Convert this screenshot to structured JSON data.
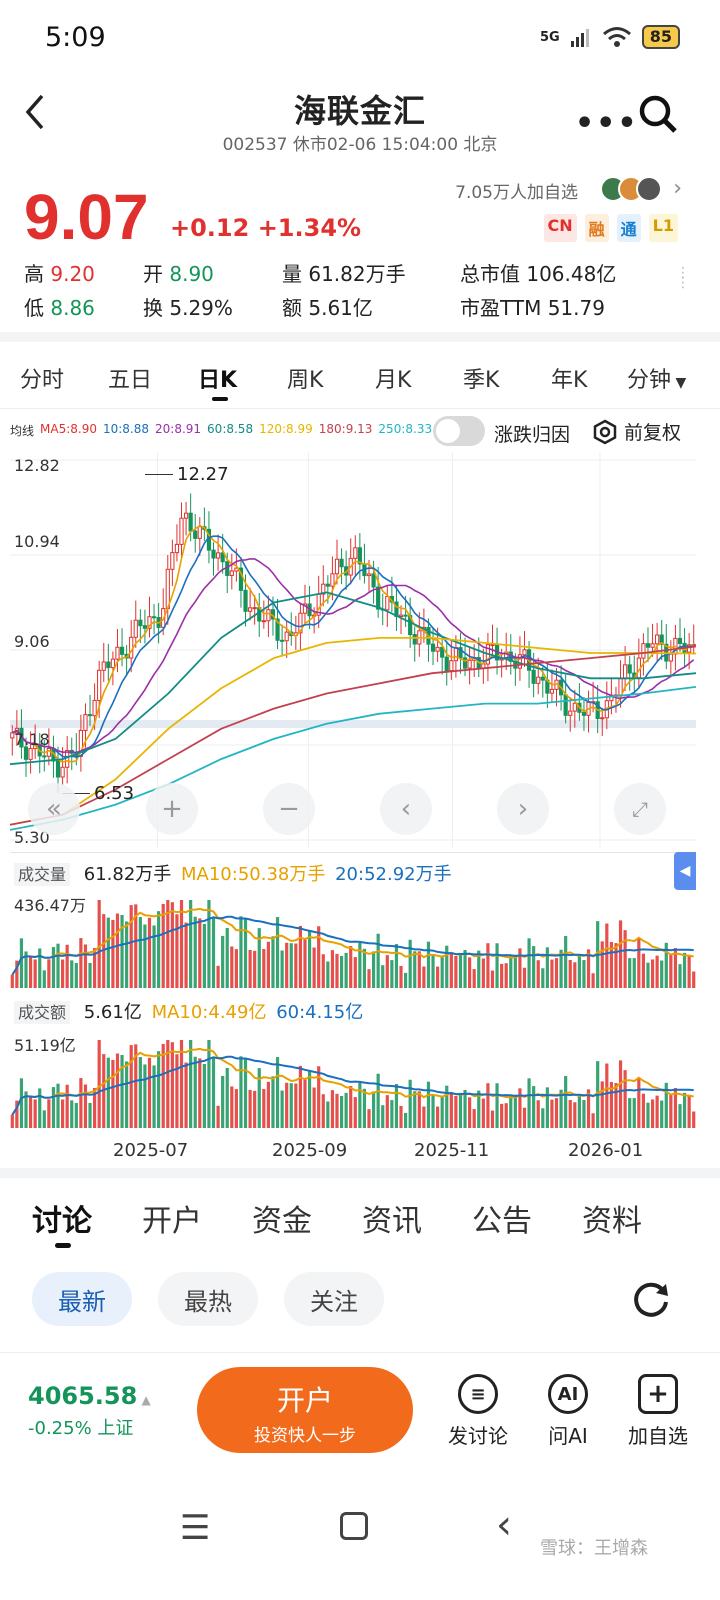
{
  "status_bar": {
    "time": "5:09",
    "network": "5G",
    "battery": "85"
  },
  "header": {
    "title": "海联金汇",
    "subtitle": "002537 休市02-06 15:04:00 北京"
  },
  "quote": {
    "price": "9.07",
    "change": "+0.12",
    "change_pct": "+1.34%",
    "followers": "7.05万人加自选",
    "badges": [
      "CN",
      "融",
      "通",
      "L1"
    ],
    "high_label": "高",
    "high": "9.20",
    "low_label": "低",
    "low": "8.86",
    "open_label": "开",
    "open": "8.90",
    "turnover_label": "换",
    "turnover": "5.29%",
    "volume_label": "量",
    "volume": "61.82万手",
    "amount_label": "额",
    "amount": "5.61亿",
    "mktcap_label": "总市值",
    "mktcap": "106.48亿",
    "pe_label": "市盈TTM",
    "pe": "51.79"
  },
  "period_tabs": [
    "分时",
    "五日",
    "日K",
    "周K",
    "月K",
    "季K",
    "年K",
    "分钟"
  ],
  "active_period": "日K",
  "ma_legend": {
    "label": "均线",
    "items": [
      {
        "text": "MA5:8.90",
        "color": "#e0312e"
      },
      {
        "text": "10:8.88",
        "color": "#1a6fbf"
      },
      {
        "text": "20:8.91",
        "color": "#9b2fa8"
      },
      {
        "text": "60:8.58",
        "color": "#138c86"
      },
      {
        "text": "120:8.99",
        "color": "#e8b500"
      },
      {
        "text": "180:9.13",
        "color": "#c2414f"
      },
      {
        "text": "250:8.33",
        "color": "#22b5c4"
      }
    ],
    "toggle_label": "涨跌归因",
    "adjust_label": "前复权"
  },
  "chart_axes": {
    "price_ticks": [
      "12.82",
      "10.94",
      "9.06",
      "7.18",
      "5.30"
    ],
    "max_label": "12.27",
    "min_label": "6.53",
    "x_ticks": [
      "2025-07",
      "2025-09",
      "2025-11",
      "2026-01"
    ]
  },
  "volume_panel": {
    "label": "成交量",
    "value": "61.82万手",
    "ma10": "MA10:50.38万手",
    "ma20": "20:52.92万手",
    "max": "436.47万"
  },
  "amount_panel": {
    "label": "成交额",
    "value": "5.61亿",
    "ma10": "MA10:4.49亿",
    "ma60": "60:4.15亿",
    "max": "51.19亿"
  },
  "bottom_tabs": [
    "讨论",
    "开户",
    "资金",
    "资讯",
    "公告",
    "资料"
  ],
  "filter_chips": [
    "最新",
    "最热",
    "关注"
  ],
  "index": {
    "value": "4065.58",
    "change": "-0.25%",
    "name": "上证"
  },
  "open_account": {
    "label": "开户",
    "sub": "投资快人一步"
  },
  "actions": [
    {
      "label": "发讨论",
      "icon": "comment-icon"
    },
    {
      "label": "问AI",
      "icon": "ai-icon"
    },
    {
      "label": "加自选",
      "icon": "add-icon"
    }
  ],
  "watermark": "雪球：王增森",
  "colors": {
    "up": "#e0312e",
    "down": "#15945a",
    "accent": "#f26b1d"
  },
  "chart_data": {
    "type": "candlestick",
    "x_ticks": [
      "2025-07",
      "2025-09",
      "2025-11",
      "2026-01"
    ],
    "y_ticks": [
      12.82,
      10.94,
      9.06,
      7.18,
      5.3
    ],
    "ylim": [
      5.3,
      12.82
    ],
    "close_path_approx": [
      7.3,
      7.1,
      6.8,
      7.0,
      8.5,
      9.0,
      9.5,
      9.8,
      11.8,
      11.2,
      10.8,
      10.0,
      9.6,
      9.3,
      9.9,
      10.5,
      11.0,
      10.2,
      9.8,
      9.4,
      9.0,
      8.8,
      8.9,
      9.0,
      8.8,
      8.4,
      8.0,
      7.8,
      8.0,
      8.7,
      9.2,
      9.1,
      9.07
    ],
    "series": [
      {
        "name": "MA60",
        "values": [
          6.8,
          6.9,
          7.3,
          8.2,
          9.3,
          10.0,
          10.2,
          9.9,
          9.4,
          9.0,
          8.7,
          8.5,
          8.5,
          8.6
        ]
      },
      {
        "name": "MA120",
        "values": [
          5.6,
          5.8,
          6.5,
          7.5,
          8.3,
          8.9,
          9.2,
          9.3,
          9.3,
          9.2,
          9.1,
          9.0,
          9.0,
          8.99
        ]
      },
      {
        "name": "MA180",
        "values": [
          5.6,
          5.8,
          6.3,
          6.9,
          7.5,
          7.9,
          8.2,
          8.4,
          8.6,
          8.7,
          8.8,
          8.9,
          9.0,
          9.13
        ]
      },
      {
        "name": "MA250",
        "values": [
          5.5,
          5.7,
          6.0,
          6.4,
          6.9,
          7.3,
          7.6,
          7.8,
          7.9,
          8.0,
          8.0,
          8.1,
          8.2,
          8.33
        ]
      }
    ],
    "max_marker": 12.27,
    "min_marker": 6.53
  }
}
